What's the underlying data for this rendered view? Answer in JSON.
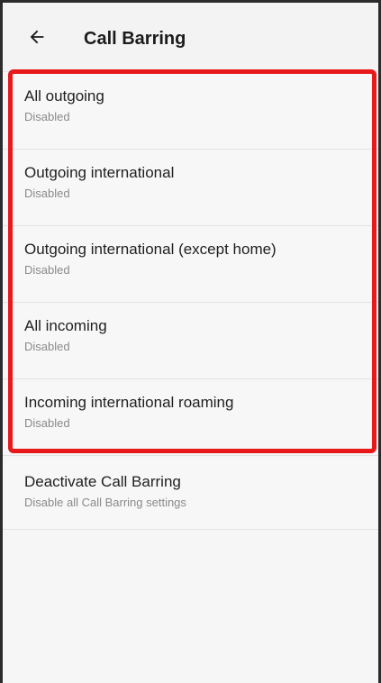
{
  "header": {
    "back_icon": "arrow-back-icon",
    "title": "Call Barring"
  },
  "items": [
    {
      "label": "All outgoing",
      "status": "Disabled"
    },
    {
      "label": "Outgoing international",
      "status": "Disabled"
    },
    {
      "label": "Outgoing international (except home)",
      "status": "Disabled"
    },
    {
      "label": "All incoming",
      "status": "Disabled"
    },
    {
      "label": "Incoming international roaming",
      "status": "Disabled"
    }
  ],
  "deactivate": {
    "label": "Deactivate Call Barring",
    "description": "Disable all Call Barring settings"
  },
  "colors": {
    "highlight": "#e8191a",
    "background": "#f6f6f6"
  }
}
